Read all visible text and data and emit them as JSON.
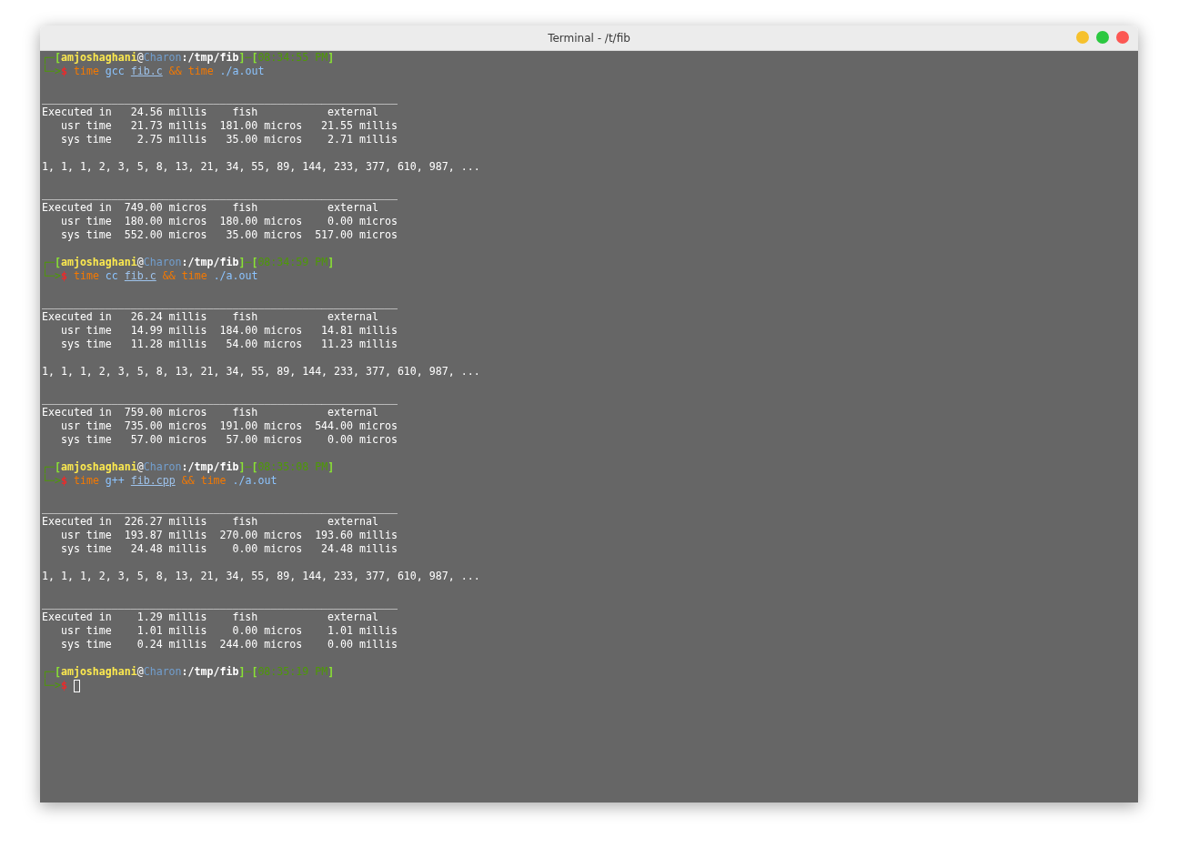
{
  "window": {
    "title": "Terminal - /t/fib"
  },
  "lines": [
    {
      "kind": "prompt",
      "segments": [
        {
          "kind": "line",
          "text": "┌─"
        },
        {
          "kind": "bracket",
          "text": "["
        },
        {
          "kind": "user",
          "text": "amjoshaghani"
        },
        {
          "kind": "at",
          "text": "@"
        },
        {
          "kind": "host",
          "text": "Charon"
        },
        {
          "kind": "path",
          "text": ":/tmp/fib"
        },
        {
          "kind": "bracket",
          "text": "]"
        },
        {
          "kind": "line",
          "text": "─"
        },
        {
          "kind": "bracket",
          "text": "["
        },
        {
          "kind": "time",
          "text": "08:34:55 PM"
        },
        {
          "kind": "bracket",
          "text": "]"
        }
      ]
    },
    {
      "kind": "command",
      "arrow": "└─>",
      "sigil": "$",
      "tokens": [
        {
          "kind": "keyword",
          "text": "time"
        },
        {
          "kind": "program",
          "text": "gcc"
        },
        {
          "kind": "file",
          "text": "fib.c"
        },
        {
          "kind": "keyword",
          "text": "&&"
        },
        {
          "kind": "keyword",
          "text": "time"
        },
        {
          "kind": "program",
          "text": "./a.out"
        }
      ]
    },
    {
      "kind": "blank"
    },
    {
      "kind": "text",
      "text": "________________________________________________________"
    },
    {
      "kind": "text",
      "text": "Executed in   24.56 millis    fish           external"
    },
    {
      "kind": "text",
      "text": "   usr time   21.73 millis  181.00 micros   21.55 millis"
    },
    {
      "kind": "text",
      "text": "   sys time    2.75 millis   35.00 micros    2.71 millis"
    },
    {
      "kind": "blank"
    },
    {
      "kind": "text",
      "text": "1, 1, 1, 2, 3, 5, 8, 13, 21, 34, 55, 89, 144, 233, 377, 610, 987, ..."
    },
    {
      "kind": "blank"
    },
    {
      "kind": "text",
      "text": "________________________________________________________"
    },
    {
      "kind": "text",
      "text": "Executed in  749.00 micros    fish           external"
    },
    {
      "kind": "text",
      "text": "   usr time  180.00 micros  180.00 micros    0.00 micros"
    },
    {
      "kind": "text",
      "text": "   sys time  552.00 micros   35.00 micros  517.00 micros"
    },
    {
      "kind": "blank"
    },
    {
      "kind": "prompt",
      "segments": [
        {
          "kind": "line",
          "text": "┌─"
        },
        {
          "kind": "bracket",
          "text": "["
        },
        {
          "kind": "user",
          "text": "amjoshaghani"
        },
        {
          "kind": "at",
          "text": "@"
        },
        {
          "kind": "host",
          "text": "Charon"
        },
        {
          "kind": "path",
          "text": ":/tmp/fib"
        },
        {
          "kind": "bracket",
          "text": "]"
        },
        {
          "kind": "line",
          "text": "─"
        },
        {
          "kind": "bracket",
          "text": "["
        },
        {
          "kind": "time",
          "text": "08:34:59 PM"
        },
        {
          "kind": "bracket",
          "text": "]"
        }
      ]
    },
    {
      "kind": "command",
      "arrow": "└─>",
      "sigil": "$",
      "tokens": [
        {
          "kind": "keyword",
          "text": "time"
        },
        {
          "kind": "program",
          "text": "cc"
        },
        {
          "kind": "file",
          "text": "fib.c"
        },
        {
          "kind": "keyword",
          "text": "&&"
        },
        {
          "kind": "keyword",
          "text": "time"
        },
        {
          "kind": "program",
          "text": "./a.out"
        }
      ]
    },
    {
      "kind": "blank"
    },
    {
      "kind": "text",
      "text": "________________________________________________________"
    },
    {
      "kind": "text",
      "text": "Executed in   26.24 millis    fish           external"
    },
    {
      "kind": "text",
      "text": "   usr time   14.99 millis  184.00 micros   14.81 millis"
    },
    {
      "kind": "text",
      "text": "   sys time   11.28 millis   54.00 micros   11.23 millis"
    },
    {
      "kind": "blank"
    },
    {
      "kind": "text",
      "text": "1, 1, 1, 2, 3, 5, 8, 13, 21, 34, 55, 89, 144, 233, 377, 610, 987, ..."
    },
    {
      "kind": "blank"
    },
    {
      "kind": "text",
      "text": "________________________________________________________"
    },
    {
      "kind": "text",
      "text": "Executed in  759.00 micros    fish           external"
    },
    {
      "kind": "text",
      "text": "   usr time  735.00 micros  191.00 micros  544.00 micros"
    },
    {
      "kind": "text",
      "text": "   sys time   57.00 micros   57.00 micros    0.00 micros"
    },
    {
      "kind": "blank"
    },
    {
      "kind": "prompt",
      "segments": [
        {
          "kind": "line",
          "text": "┌─"
        },
        {
          "kind": "bracket",
          "text": "["
        },
        {
          "kind": "user",
          "text": "amjoshaghani"
        },
        {
          "kind": "at",
          "text": "@"
        },
        {
          "kind": "host",
          "text": "Charon"
        },
        {
          "kind": "path",
          "text": ":/tmp/fib"
        },
        {
          "kind": "bracket",
          "text": "]"
        },
        {
          "kind": "line",
          "text": "─"
        },
        {
          "kind": "bracket",
          "text": "["
        },
        {
          "kind": "time",
          "text": "08:35:08 PM"
        },
        {
          "kind": "bracket",
          "text": "]"
        }
      ]
    },
    {
      "kind": "command",
      "arrow": "└─>",
      "sigil": "$",
      "tokens": [
        {
          "kind": "keyword",
          "text": "time"
        },
        {
          "kind": "program",
          "text": "g++"
        },
        {
          "kind": "file",
          "text": "fib.cpp"
        },
        {
          "kind": "keyword",
          "text": "&&"
        },
        {
          "kind": "keyword",
          "text": "time"
        },
        {
          "kind": "program",
          "text": "./a.out"
        }
      ]
    },
    {
      "kind": "blank"
    },
    {
      "kind": "text",
      "text": "________________________________________________________"
    },
    {
      "kind": "text",
      "text": "Executed in  226.27 millis    fish           external"
    },
    {
      "kind": "text",
      "text": "   usr time  193.87 millis  270.00 micros  193.60 millis"
    },
    {
      "kind": "text",
      "text": "   sys time   24.48 millis    0.00 micros   24.48 millis"
    },
    {
      "kind": "blank"
    },
    {
      "kind": "text",
      "text": "1, 1, 1, 2, 3, 5, 8, 13, 21, 34, 55, 89, 144, 233, 377, 610, 987, ..."
    },
    {
      "kind": "blank"
    },
    {
      "kind": "text",
      "text": "________________________________________________________"
    },
    {
      "kind": "text",
      "text": "Executed in    1.29 millis    fish           external"
    },
    {
      "kind": "text",
      "text": "   usr time    1.01 millis    0.00 micros    1.01 millis"
    },
    {
      "kind": "text",
      "text": "   sys time    0.24 millis  244.00 micros    0.00 millis"
    },
    {
      "kind": "blank"
    },
    {
      "kind": "prompt",
      "segments": [
        {
          "kind": "line",
          "text": "┌─"
        },
        {
          "kind": "bracket",
          "text": "["
        },
        {
          "kind": "user",
          "text": "amjoshaghani"
        },
        {
          "kind": "at",
          "text": "@"
        },
        {
          "kind": "host",
          "text": "Charon"
        },
        {
          "kind": "path",
          "text": ":/tmp/fib"
        },
        {
          "kind": "bracket",
          "text": "]"
        },
        {
          "kind": "line",
          "text": "─"
        },
        {
          "kind": "bracket",
          "text": "["
        },
        {
          "kind": "time",
          "text": "08:35:19 PM"
        },
        {
          "kind": "bracket",
          "text": "]"
        }
      ]
    },
    {
      "kind": "command",
      "arrow": "└─>",
      "sigil": "$",
      "cursor": true
    }
  ]
}
